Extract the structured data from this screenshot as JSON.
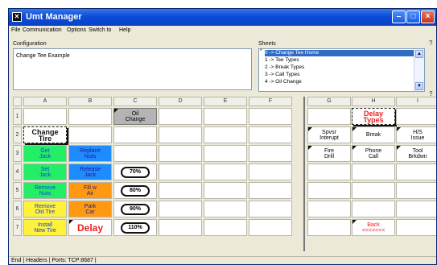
{
  "window": {
    "title": "Umt Manager"
  },
  "menu": [
    "File",
    "Communication",
    "Options",
    "Switch to",
    "Help"
  ],
  "configuration": {
    "label": "Configuration",
    "text": "Change Tee Example"
  },
  "sheets": {
    "label": "Sheets",
    "items": [
      "0 -> Change Tee Home",
      "1 -> Tee Types",
      "2 -> Break Types",
      "3 -> Call Types",
      "4 -> Oil Change"
    ]
  },
  "grid": {
    "columns": [
      "A",
      "B",
      "C",
      "D",
      "E",
      "F",
      "G",
      "H",
      "I"
    ],
    "rows": [
      "1",
      "2",
      "3",
      "4",
      "5",
      "6",
      "7"
    ],
    "cells": [
      {
        "id": "c1",
        "lines": [
          "Oil",
          "Change"
        ]
      },
      {
        "id": "h1",
        "lines": [
          "Delay",
          "Types"
        ]
      },
      {
        "id": "a2",
        "lines": [
          "Change",
          "Tire"
        ]
      },
      {
        "id": "g2",
        "lines": [
          "Spvsr",
          "Interupt"
        ]
      },
      {
        "id": "h2",
        "lines": [
          "Break"
        ]
      },
      {
        "id": "i2",
        "lines": [
          "H/S",
          "Issue"
        ]
      },
      {
        "id": "a3",
        "lines": [
          "Get",
          "Jack"
        ]
      },
      {
        "id": "b3",
        "lines": [
          "Replace",
          "Nuts"
        ]
      },
      {
        "id": "g3",
        "lines": [
          "Fire",
          "Drill"
        ]
      },
      {
        "id": "h3",
        "lines": [
          "Phone",
          "Call"
        ]
      },
      {
        "id": "i3",
        "lines": [
          "Tool",
          "Brkdwn"
        ]
      },
      {
        "id": "a4",
        "lines": [
          "Set",
          "Jack"
        ]
      },
      {
        "id": "b4",
        "lines": [
          "Release",
          "Jack"
        ]
      },
      {
        "id": "c4",
        "lines": [
          "70%"
        ]
      },
      {
        "id": "a5",
        "lines": [
          "Remove",
          "Nuts"
        ]
      },
      {
        "id": "b5",
        "lines": [
          "Fill w",
          "Air"
        ]
      },
      {
        "id": "c5",
        "lines": [
          "80%"
        ]
      },
      {
        "id": "a6",
        "lines": [
          "Remove",
          "Old Tire"
        ]
      },
      {
        "id": "b6",
        "lines": [
          "Park",
          "Car"
        ]
      },
      {
        "id": "c6",
        "lines": [
          "90%"
        ]
      },
      {
        "id": "a7",
        "lines": [
          "Install",
          "New Tire"
        ]
      },
      {
        "id": "b7",
        "lines": [
          "Delay"
        ]
      },
      {
        "id": "c7",
        "lines": [
          "110%"
        ]
      },
      {
        "id": "h7",
        "lines": [
          "Back",
          "<<<<<<<"
        ]
      }
    ]
  },
  "status": {
    "text": "End | Headers | Ports: TCP:8687 |"
  },
  "colors": {
    "green": "#22ef66",
    "blue": "#1e8cff",
    "orange": "#ff9912",
    "yellow": "#fff23b",
    "red": "#f21d1d",
    "gray": "#b4b4b4"
  }
}
